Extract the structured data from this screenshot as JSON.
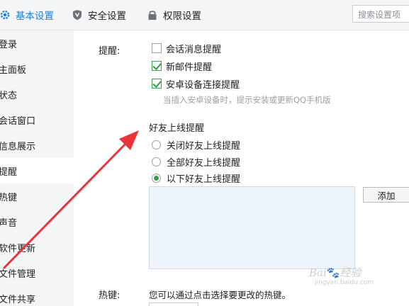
{
  "tabs": {
    "basic": "基本设置",
    "security": "安全设置",
    "permission": "权限设置"
  },
  "search": {
    "placeholder": "搜索设置项"
  },
  "sidebar": {
    "items": [
      {
        "label": "登录"
      },
      {
        "label": "主面板"
      },
      {
        "label": "状态"
      },
      {
        "label": "会话窗口"
      },
      {
        "label": "信息展示"
      },
      {
        "label": "提醒",
        "active": true
      },
      {
        "label": "热键"
      },
      {
        "label": "声音"
      },
      {
        "label": "软件更新"
      },
      {
        "label": "文件管理"
      },
      {
        "label": "文件共享"
      }
    ]
  },
  "remind": {
    "label": "提醒:",
    "checkboxes": [
      {
        "label": "会话消息提醒",
        "checked": false
      },
      {
        "label": "新邮件提醒",
        "checked": true
      },
      {
        "label": "安卓设备连接提醒",
        "checked": true
      }
    ],
    "hint": "当插入安卓设备时，提示安装或更新QQ手机版"
  },
  "friend_online": {
    "title": "好友上线提醒",
    "options": [
      {
        "label": "关闭好友上线提醒",
        "checked": false
      },
      {
        "label": "全部好友上线提醒",
        "checked": false
      },
      {
        "label": "以下好友上线提醒",
        "checked": true
      }
    ],
    "add_button": "添加"
  },
  "hotkey": {
    "label": "热键:",
    "description": "您可以通过点击选择要更改的热键。"
  },
  "watermark": {
    "main": "Bai 经验",
    "sub": "jingyan.baidu.com"
  },
  "colors": {
    "accent": "#1a7fd6",
    "check": "#2f9e44",
    "arrow": "#e8343a"
  }
}
